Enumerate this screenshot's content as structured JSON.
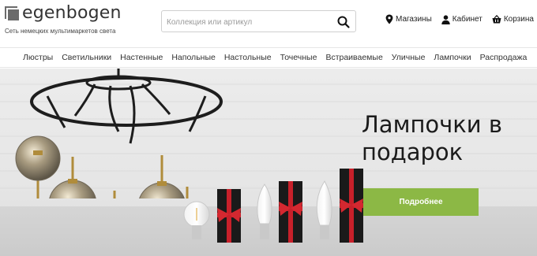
{
  "header": {
    "logo_text": "egenbogen",
    "logo_subtitle": "Сеть немецких мультимаркетов света",
    "search_placeholder": "Коллекция или артикул",
    "actions": [
      {
        "label": "Магазины",
        "icon": "map-pin-icon"
      },
      {
        "label": "Кабинет",
        "icon": "user-icon"
      },
      {
        "label": "Корзина",
        "icon": "basket-icon"
      }
    ]
  },
  "nav": {
    "items": [
      "Люстры",
      "Светильники",
      "Настенные",
      "Напольные",
      "Настольные",
      "Точечные",
      "Встраиваемые",
      "Уличные",
      "Лампочки",
      "Распродажа"
    ]
  },
  "hero": {
    "title_line1": "Лампочки в",
    "title_line2": "подарок",
    "button_label": "Подробнее",
    "button_color": "#8cb845"
  }
}
